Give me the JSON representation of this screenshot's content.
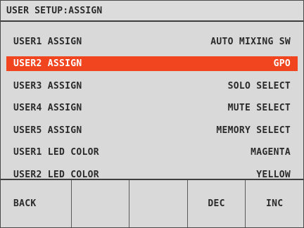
{
  "title": "USER SETUP:ASSIGN",
  "rows": [
    {
      "label": "USER1 ASSIGN",
      "value": "AUTO MIXING SW",
      "selected": false
    },
    {
      "label": "USER2 ASSIGN",
      "value": "GPO",
      "selected": true
    },
    {
      "label": "USER3 ASSIGN",
      "value": "SOLO SELECT",
      "selected": false
    },
    {
      "label": "USER4 ASSIGN",
      "value": "MUTE SELECT",
      "selected": false
    },
    {
      "label": "USER5 ASSIGN",
      "value": "MEMORY SELECT",
      "selected": false
    },
    {
      "label": "USER1 LED COLOR",
      "value": "MAGENTA",
      "selected": false
    },
    {
      "label": "USER2 LED COLOR",
      "value": "YELLOW",
      "selected": false
    }
  ],
  "softkeys": [
    "BACK",
    "",
    "",
    "DEC",
    "INC"
  ],
  "colors": {
    "selection": "#f0451f",
    "background": "#d9d9d9"
  }
}
